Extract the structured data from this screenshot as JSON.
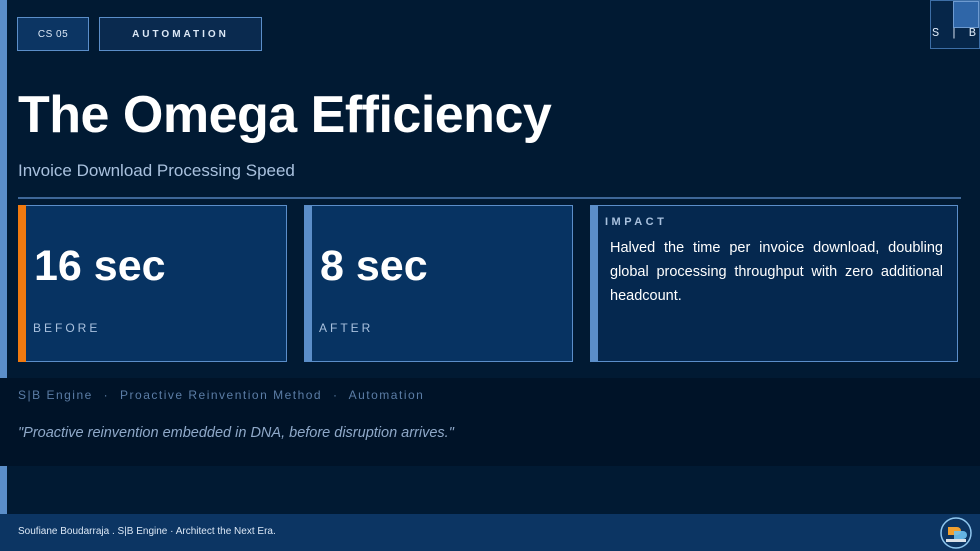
{
  "tags": {
    "case": "CS 05",
    "category": "AUTOMATION"
  },
  "brand": "S | B",
  "title": "The Omega Efficiency",
  "subtitle": "Invoice Download Processing Speed",
  "before": {
    "value": "16 sec",
    "label": "BEFORE"
  },
  "after": {
    "value": "8 sec",
    "label": "AFTER"
  },
  "impact": {
    "label": "IMPACT",
    "text": "Halved the time per invoice download, doubling global processing throughput with zero additional headcount."
  },
  "method": {
    "engine": "S|B Engine",
    "sep": "·",
    "method": "Proactive Reinvention Method",
    "category": "Automation"
  },
  "quote": "\"Proactive reinvention embedded in DNA, before disruption arrives.\"",
  "footer": "Soufiane Boudarraja .  S|B  Engine ·  Architect the Next Era.",
  "colors": {
    "accent_before": "#f07a10",
    "accent_blue": "#5b8ec9",
    "background": "#011a33"
  }
}
